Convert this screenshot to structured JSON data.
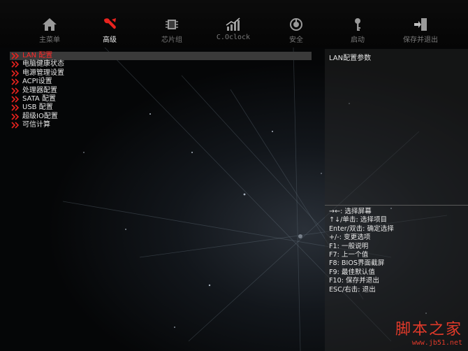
{
  "nav": {
    "tabs": [
      {
        "label": "主菜单",
        "icon": "home-icon"
      },
      {
        "label": "高级",
        "icon": "wrench-icon"
      },
      {
        "label": "芯片组",
        "icon": "chip-icon"
      },
      {
        "label": "C.Oclock",
        "icon": "performance-graph-icon"
      },
      {
        "label": "安全",
        "icon": "shield-power-icon"
      },
      {
        "label": "启动",
        "icon": "key-icon"
      },
      {
        "label": "保存并退出",
        "icon": "exit-door-icon"
      }
    ],
    "active_tab": "高级"
  },
  "menu": {
    "items": [
      {
        "label": "LAN 配置"
      },
      {
        "label": "电脑健康状态"
      },
      {
        "label": "电源管理设置"
      },
      {
        "label": "ACPI设置"
      },
      {
        "label": "处理器配置"
      },
      {
        "label": "SATA 配置"
      },
      {
        "label": "USB 配置"
      },
      {
        "label": "超级IO配置"
      },
      {
        "label": "可信计算"
      }
    ],
    "selected_index": 0
  },
  "help": {
    "title": "LAN配置参数",
    "keys": [
      "→←: 选择屏幕",
      "↑↓/单击: 选择项目",
      "Enter/双击: 确定选择",
      "+/-: 变更选项",
      "F1: 一般说明",
      "F7: 上一个值",
      "F8: BIOS界面截屏",
      "F9: 最佳默认值",
      "F10: 保存并退出",
      "ESC/右击: 退出"
    ]
  },
  "watermark": {
    "text": "脚本之家",
    "url": "www.jb51.net"
  },
  "colors": {
    "accent": "#ff2a2a",
    "selection_bg": "#3a3a3a",
    "background": "#050607"
  }
}
